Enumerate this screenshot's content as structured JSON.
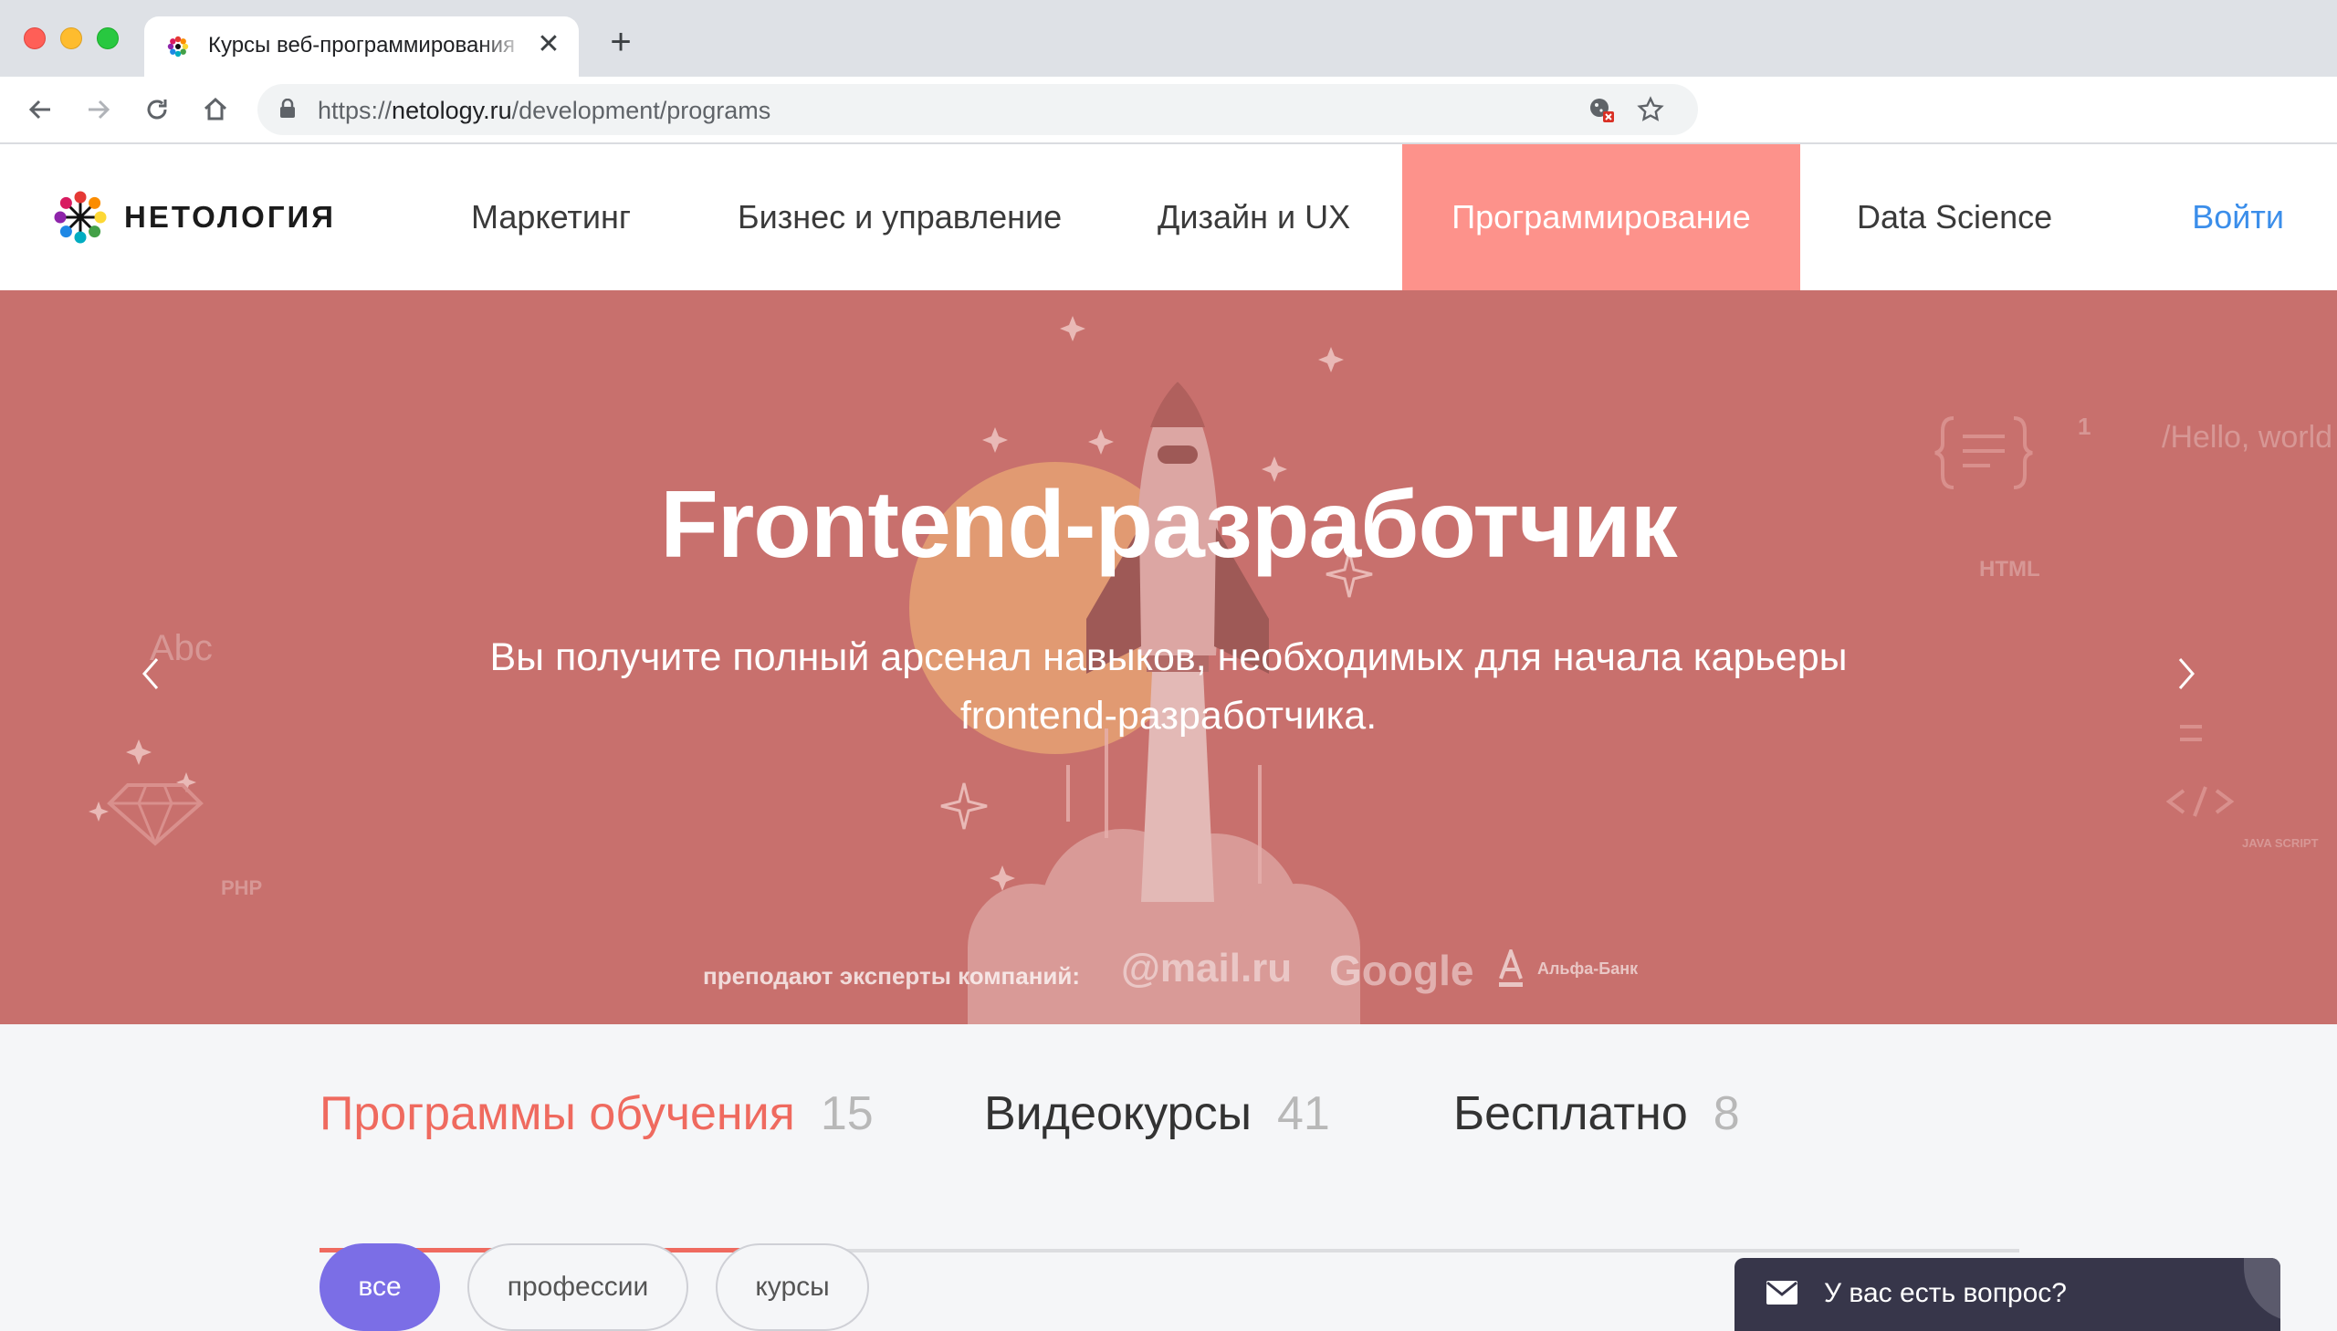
{
  "browser": {
    "tab_title": "Курсы веб-программирования",
    "tab_close": "✕",
    "new_tab": "+",
    "url_scheme": "https://",
    "url_domain": "netology.ru",
    "url_path": "/development/programs",
    "extensions": [
      "color-palette-icon",
      "php-icon",
      "eyedropper-icon",
      "globe-icon",
      "brain-icon",
      "download-icon",
      "hourglass-icon",
      "moon-icon"
    ],
    "php_label": "php"
  },
  "header": {
    "logo_text": "НЕТОЛОГИЯ",
    "nav": [
      {
        "label": "Маркетинг"
      },
      {
        "label": "Бизнес и управление"
      },
      {
        "label": "Дизайн и UX"
      },
      {
        "label": "Программирование",
        "active": true
      },
      {
        "label": "Data Science"
      }
    ],
    "login": "Войти",
    "active_color": "#fd928b"
  },
  "hero": {
    "title": "Frontend-разработчик",
    "subtitle_line1": "Вы получите полный арсенал навыков, необходимых для начала карьеры",
    "subtitle_line2": "frontend-разработчика.",
    "experts_label": "преподают эксперты компаний:",
    "partners": {
      "mail": "@mail.ru",
      "google": "Google",
      "alfa": "Альфа-Банк"
    },
    "decor": {
      "abc": "Abc",
      "php": "PHP",
      "html": "HTML",
      "hello": "/Hello, world",
      "one": "1",
      "js": "JAVA SCRIPT"
    },
    "bg_color": "#c8706d"
  },
  "tabs": [
    {
      "label": "Программы обучения",
      "count": "15",
      "active": true
    },
    {
      "label": "Видеокурсы",
      "count": "41"
    },
    {
      "label": "Бесплатно",
      "count": "8"
    }
  ],
  "filters": [
    {
      "label": "все",
      "active": true
    },
    {
      "label": "профессии"
    },
    {
      "label": "курсы"
    }
  ],
  "chat": {
    "label": "У вас есть вопрос?"
  }
}
